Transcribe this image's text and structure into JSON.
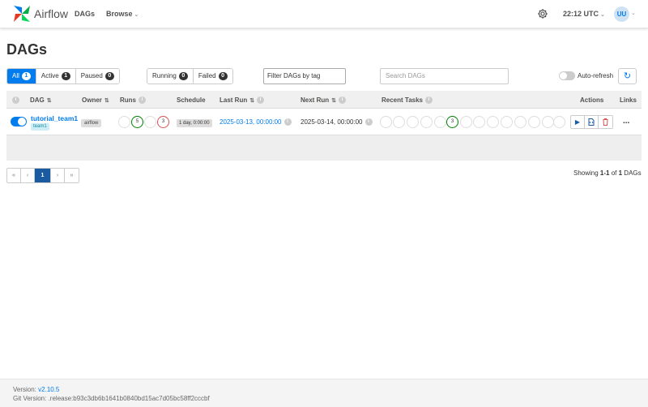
{
  "app": {
    "brand": "Airflow"
  },
  "nav": {
    "dags": "DAGs",
    "browse": "Browse",
    "time": "22:12 UTC",
    "user_initials": "UU"
  },
  "page": {
    "title": "DAGs"
  },
  "filters": {
    "status": [
      {
        "label": "All",
        "count": "1"
      },
      {
        "label": "Active",
        "count": "1"
      },
      {
        "label": "Paused",
        "count": "0"
      }
    ],
    "runs": [
      {
        "label": "Running",
        "count": "0"
      },
      {
        "label": "Failed",
        "count": "0"
      }
    ],
    "tag_placeholder": "Filter DAGs by tag",
    "search_placeholder": "Search DAGs",
    "auto_refresh": "Auto-refresh"
  },
  "table": {
    "headers": {
      "dag": "DAG",
      "owner": "Owner",
      "runs": "Runs",
      "schedule": "Schedule",
      "last_run": "Last Run",
      "next_run": "Next Run",
      "recent_tasks": "Recent Tasks",
      "actions": "Actions",
      "links": "Links"
    },
    "rows": [
      {
        "dag_id": "tutorial_team1",
        "tag": "team1",
        "owner": "airflow",
        "runs_success": "5",
        "runs_failed": "3",
        "schedule": "1 day, 0:00:00",
        "last_run": "2025-03-13, 00:00:00",
        "next_run": "2025-03-14, 00:00:00",
        "recent_success": "3",
        "links_icon": "..."
      }
    ]
  },
  "pagination": {
    "first": "«",
    "prev": "‹",
    "current": "1",
    "next": "›",
    "last": "»",
    "showing_prefix": "Showing ",
    "showing_range": "1-1",
    "showing_of": " of ",
    "showing_total": "1",
    "showing_suffix": " DAGs"
  },
  "footer": {
    "version_label": "Version: ",
    "version": "v2.10.5",
    "git_label": "Git Version: ",
    "git": ".release:b93c3db6b1641b0840bd15ac7d05bc58ff2cccbf"
  },
  "colors": {
    "accent": "#017cee",
    "success": "#008000",
    "failed": "#d9534f"
  },
  "icons": {
    "logo": "airflow-pinwheel-icon",
    "settings": "gear-icon",
    "refresh": "refresh-icon",
    "trigger": "play-icon",
    "code": "file-code-icon",
    "delete": "trash-icon"
  }
}
